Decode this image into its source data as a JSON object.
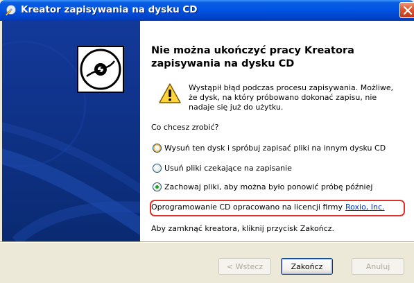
{
  "window": {
    "title": "Kreator zapisywania na dysku CD",
    "title_icon": "cd-writer-icon",
    "close_icon": "close-icon"
  },
  "side_panel": {
    "icon": "cd-disc-icon",
    "background_color": "#0C3486"
  },
  "main": {
    "heading": "Nie można ukończyć pracy Kreatora zapisywania na dysku CD",
    "warning_icon": "warning-icon",
    "error_message": "Wystąpił błąd podczas procesu zapisywania. Możliwe, że dysk, na który próbowano dokonać zapisu, nie nadaje się już do użytku.",
    "question": "Co chcesz zrobić?",
    "options": [
      {
        "label": "Wysuń ten dysk i spróbuj zapisać pliki na innym dysku CD",
        "selected": false
      },
      {
        "label": "Usuń pliki czekające na zapisanie",
        "selected": false
      },
      {
        "label": "Zachowaj pliki, aby można było ponowić próbę później",
        "selected": true
      }
    ],
    "license_text": "Oprogramowanie CD opracowano na licencji firmy",
    "license_link": "Roxio, Inc.",
    "close_hint": "Aby zamknąć kreatora, kliknij przycisk Zakończ."
  },
  "buttons": {
    "back": "< Wstecz",
    "finish": "Zakończ",
    "cancel": "Anuluj"
  },
  "colors": {
    "titlebar": "#0055E5",
    "highlight_border": "#E0302A",
    "link": "#0033CC"
  }
}
